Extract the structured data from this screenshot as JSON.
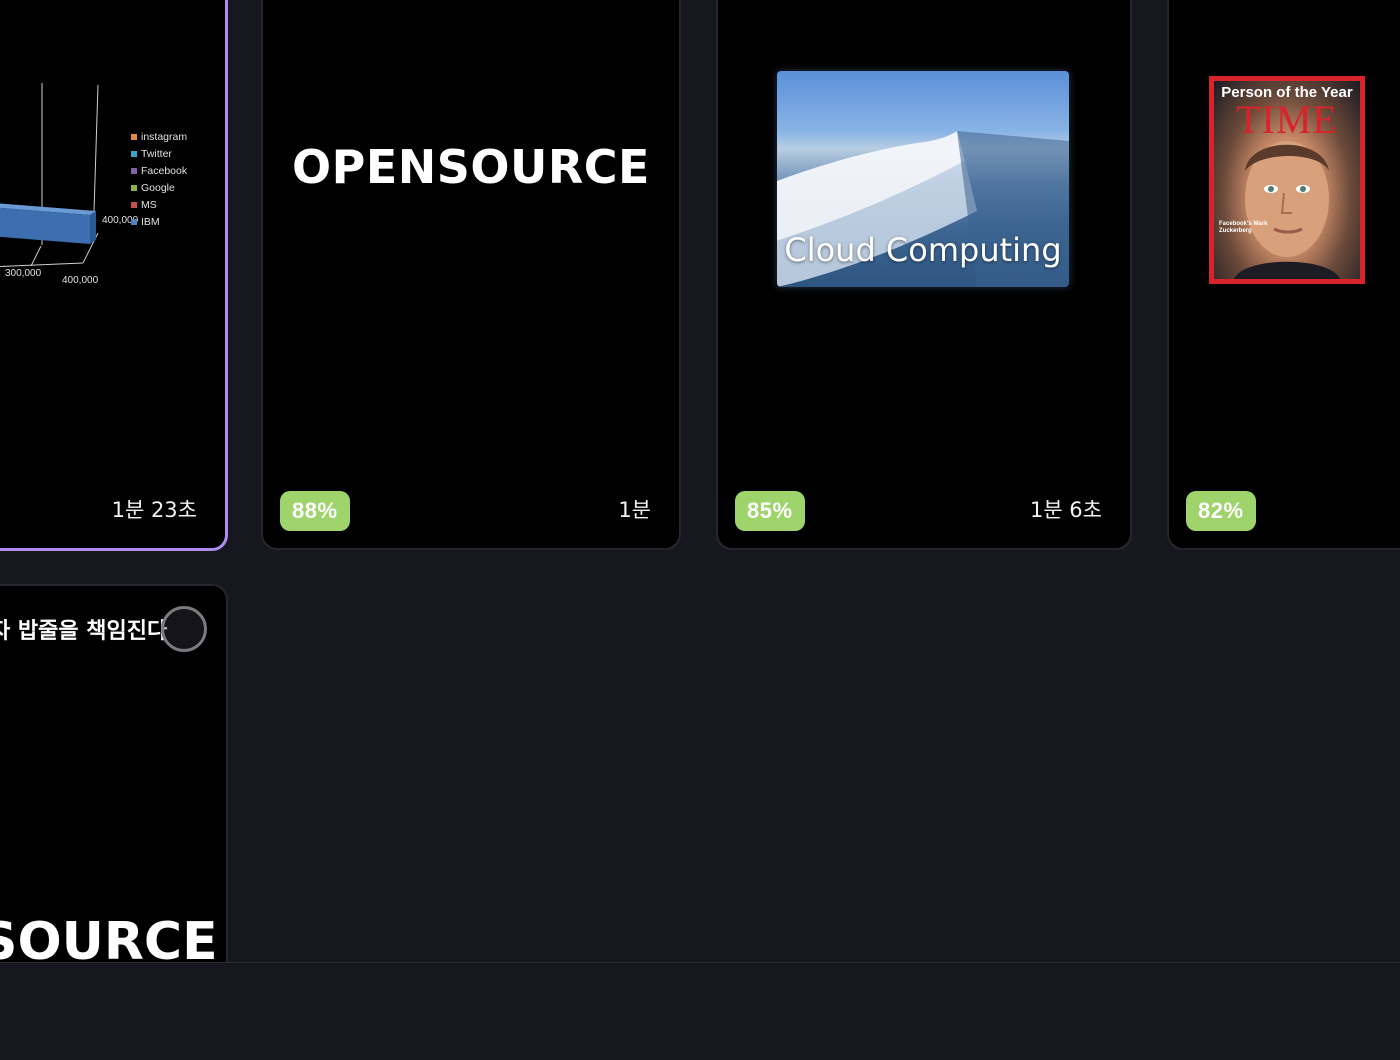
{
  "cards": [
    {
      "id": "chart-slide",
      "selected": true,
      "badge": "",
      "duration": "1분 23초",
      "legend": [
        {
          "label": "instagram",
          "color": "#e08a4a"
        },
        {
          "label": "Twitter",
          "color": "#3aa5c8"
        },
        {
          "label": "Facebook",
          "color": "#7f62a8"
        },
        {
          "label": "Google",
          "color": "#8db04a"
        },
        {
          "label": "MS",
          "color": "#c0504d"
        },
        {
          "label": "IBM",
          "color": "#4f81bd"
        }
      ],
      "bar_label": "400,000",
      "axis_ticks": [
        "300,000",
        "400,000"
      ]
    },
    {
      "id": "opensource-slide",
      "title": "OPENSOURCE",
      "badge": "88%",
      "duration": "1분"
    },
    {
      "id": "cloud-slide",
      "caption": "Cloud Computing",
      "badge": "85%",
      "duration": "1분 6초"
    },
    {
      "id": "time-slide",
      "badge": "82%",
      "duration": "",
      "magazine_headline": "Person of the Year",
      "magazine_brand": "TIME",
      "magazine_cover_text": "Facebook's Mark Zuckerberg"
    }
  ],
  "row2": {
    "caption": "자 밥줄을 책임진다",
    "big_text": "SOURCE"
  }
}
